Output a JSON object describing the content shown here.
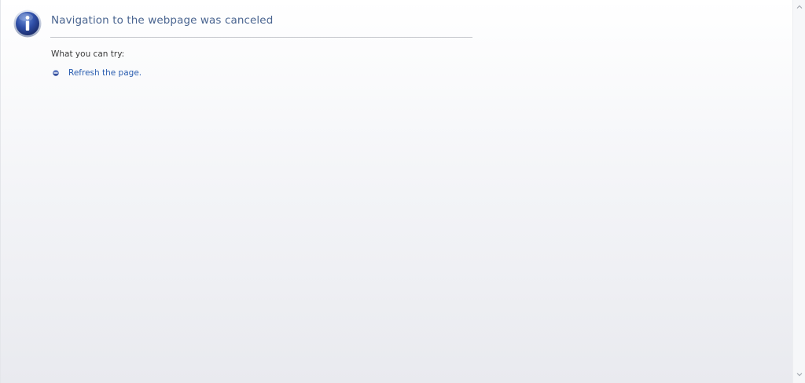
{
  "page": {
    "title": "Navigation to the webpage was canceled",
    "subtitle": "What you can try:",
    "suggestions": [
      {
        "label": "Refresh the page.",
        "icon": "bullet-icon"
      }
    ]
  },
  "icons": {
    "header": "info-icon",
    "scroll_up": "chevron-up-icon",
    "scroll_down": "chevron-down-icon"
  },
  "colors": {
    "title": "#4a6590",
    "link": "#2a5db0",
    "icon_blue": "#2c4a9c"
  }
}
